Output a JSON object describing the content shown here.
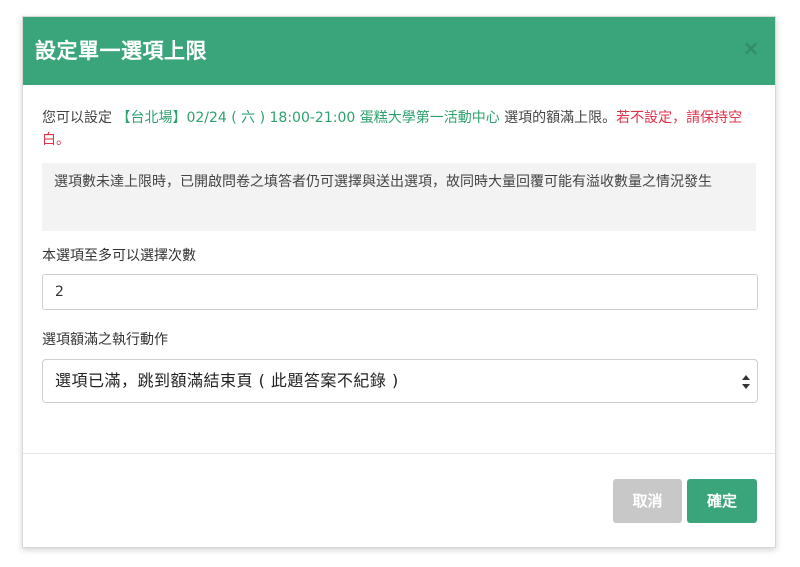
{
  "dialog": {
    "title": "設定單一選項上限",
    "close_label": "×"
  },
  "intro": {
    "prefix": "您可以設定 ",
    "option_name": "【台北場】02/24 ( 六 ) 18:00-21:00 蛋糕大學第一活動中心",
    "middle": " 選項的額滿上限。",
    "warning": "若不設定，請保持空白。"
  },
  "notice": "選項數未達上限時，已開啟問卷之填答者仍可選擇與送出選項，故同時大量回覆可能有溢收數量之情況發生",
  "max_count": {
    "label": "本選項至多可以選擇次數",
    "value": "2"
  },
  "full_action": {
    "label": "選項額滿之執行動作",
    "selected": "選項已滿，跳到額滿結束頁 ( 此題答案不紀錄 )"
  },
  "buttons": {
    "cancel": "取消",
    "confirm": "確定"
  },
  "colors": {
    "header": "#3aa57a",
    "highlight_green": "#2ea26e",
    "warning_red": "#e0334a",
    "cancel_button": "#c8c8c8"
  }
}
